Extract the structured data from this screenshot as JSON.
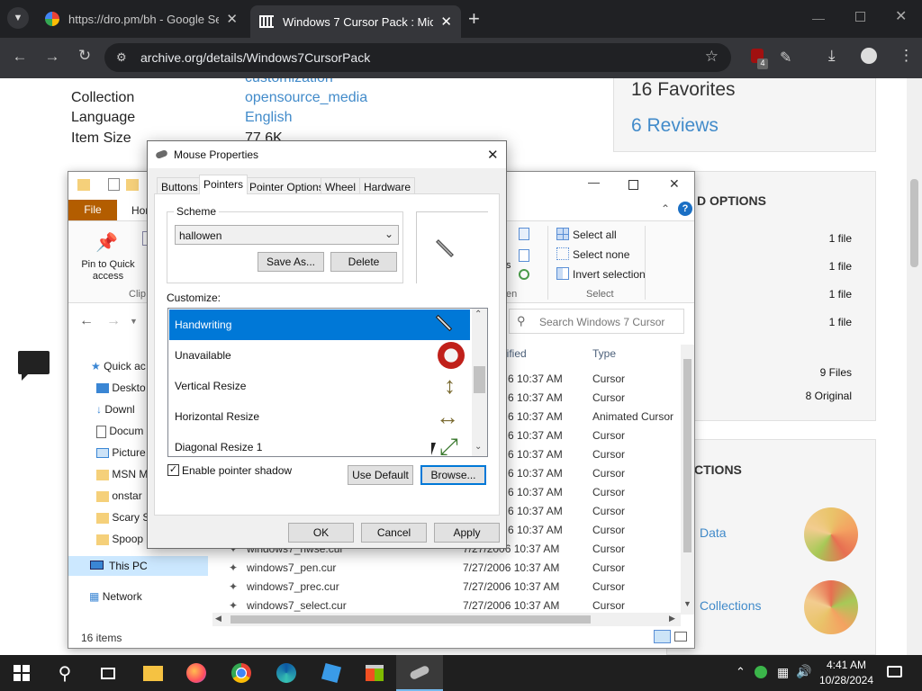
{
  "browser": {
    "tabs": [
      {
        "title": "https://dro.pm/bh - Google Search",
        "active": false
      },
      {
        "title": "Windows 7 Cursor Pack : Microsoft",
        "active": true
      }
    ],
    "new_tab": "+",
    "url": "archive.org/details/Windows7CursorPack",
    "extension_badge": "4"
  },
  "archive_page": {
    "metadata": [
      {
        "label": "Collection",
        "value": "customization"
      },
      {
        "label": "",
        "value": "opensource_media"
      },
      {
        "label": "Language",
        "value": "English"
      },
      {
        "label": "Item Size",
        "value": "77.6K"
      }
    ],
    "favorites": "16 Favorites",
    "reviews": "6 Reviews",
    "download_options_heading": "D OPTIONS",
    "download_rows": [
      "1 file",
      "1 file",
      "1 file",
      "1 file"
    ],
    "files_count": "9 Files",
    "original_count": "8 Original",
    "collections_heading": "CTIONS",
    "collections": [
      "Data",
      "Collections"
    ]
  },
  "explorer": {
    "ribbon": {
      "file_tab": "File",
      "home_tab": "Hom",
      "pin_label": "Pin to Quick access",
      "clip_label": "Clip",
      "select_all": "Select all",
      "select_none": "Select none",
      "invert_selection": "Invert selection",
      "select_group": "Select",
      "open_group_fragment": "en",
      "fragment_s": "s"
    },
    "search_placeholder": "Search Windows 7 Cursor",
    "columns": {
      "date": "dified",
      "type": "Type"
    },
    "nav": [
      "Quick ac",
      "Deskto",
      "Downl",
      "Docum",
      "Picture",
      "MSN M",
      "onstar",
      "Scary S",
      "Spoop",
      "This PC",
      "Network"
    ],
    "rows": [
      {
        "name": "",
        "date": "6 10:37 AM",
        "type": "Cursor"
      },
      {
        "name": "",
        "date": "6 10:37 AM",
        "type": "Cursor"
      },
      {
        "name": "",
        "date": "6 10:37 AM",
        "type": "Animated Cursor"
      },
      {
        "name": "",
        "date": "6 10:37 AM",
        "type": "Cursor"
      },
      {
        "name": "",
        "date": "6 10:37 AM",
        "type": "Cursor"
      },
      {
        "name": "",
        "date": "6 10:37 AM",
        "type": "Cursor"
      },
      {
        "name": "",
        "date": "6 10:37 AM",
        "type": "Cursor"
      },
      {
        "name": "",
        "date": "6 10:37 AM",
        "type": "Cursor"
      },
      {
        "name": "",
        "date": "6 10:37 AM",
        "type": "Cursor"
      },
      {
        "name": "windows7_nwse.cur",
        "date": "7/27/2006 10:37 AM",
        "type": "Cursor"
      },
      {
        "name": "windows7_pen.cur",
        "date": "7/27/2006 10:37 AM",
        "type": "Cursor"
      },
      {
        "name": "windows7_prec.cur",
        "date": "7/27/2006 10:37 AM",
        "type": "Cursor"
      },
      {
        "name": "windows7_select.cur",
        "date": "7/27/2006 10:37 AM",
        "type": "Cursor"
      }
    ],
    "status": "16 items"
  },
  "dialog": {
    "title": "Mouse Properties",
    "tabs": [
      "Buttons",
      "Pointers",
      "Pointer Options",
      "Wheel",
      "Hardware"
    ],
    "active_tab": "Pointers",
    "scheme_label": "Scheme",
    "scheme_value": "hallowen",
    "save_as": "Save As...",
    "delete": "Delete",
    "customize_label": "Customize:",
    "cursors": [
      "Handwriting",
      "Unavailable",
      "Vertical Resize",
      "Horizontal Resize",
      "Diagonal Resize 1"
    ],
    "selected_cursor": "Handwriting",
    "shadow_label": "Enable pointer shadow",
    "shadow_checked": true,
    "use_default": "Use Default",
    "browse": "Browse...",
    "ok": "OK",
    "cancel": "Cancel",
    "apply": "Apply"
  },
  "taskbar": {
    "time": "4:41 AM",
    "date": "10/28/2024"
  },
  "colors": {
    "chrome_dark": "#202124",
    "chrome_toolbar": "#35363a",
    "link_blue": "#428bca",
    "selection_blue": "#0078d7",
    "ribbon_file": "#b35d00"
  }
}
